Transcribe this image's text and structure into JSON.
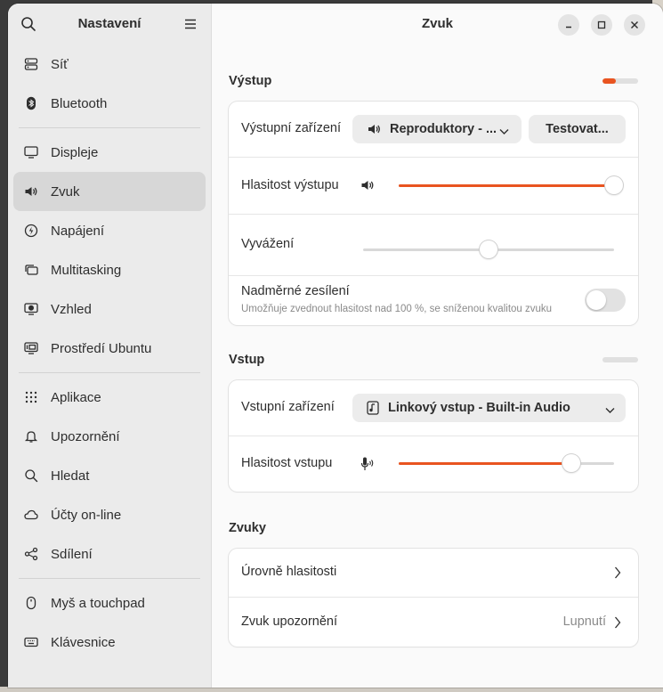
{
  "sidebar": {
    "title": "Nastavení",
    "groups": [
      [
        {
          "label": "Síť",
          "icon": "network-icon"
        },
        {
          "label": "Bluetooth",
          "icon": "bluetooth-icon"
        }
      ],
      [
        {
          "label": "Displeje",
          "icon": "display-icon"
        },
        {
          "label": "Zvuk",
          "icon": "speaker-icon",
          "active": true
        },
        {
          "label": "Napájení",
          "icon": "power-icon"
        },
        {
          "label": "Multitasking",
          "icon": "multitasking-icon"
        },
        {
          "label": "Vzhled",
          "icon": "appearance-icon"
        },
        {
          "label": "Prostředí Ubuntu",
          "icon": "ubuntu-desktop-icon"
        }
      ],
      [
        {
          "label": "Aplikace",
          "icon": "apps-grid-icon"
        },
        {
          "label": "Upozornění",
          "icon": "bell-icon"
        },
        {
          "label": "Hledat",
          "icon": "search-icon"
        },
        {
          "label": "Účty on-line",
          "icon": "cloud-icon"
        },
        {
          "label": "Sdílení",
          "icon": "share-icon"
        }
      ],
      [
        {
          "label": "Myš a touchpad",
          "icon": "mouse-icon"
        },
        {
          "label": "Klávesnice",
          "icon": "keyboard-icon"
        }
      ]
    ]
  },
  "main": {
    "title": "Zvuk",
    "output": {
      "title": "Výstup",
      "level": 0.38,
      "device_label": "Výstupní zařízení",
      "device_value": "Reproduktory - ...",
      "test_label": "Testovat...",
      "volume_label": "Hlasitost výstupu",
      "volume": 1.0,
      "balance_label": "Vyvážení",
      "balance": 0.5,
      "overamp_label": "Nadměrné zesílení",
      "overamp_desc": "Umožňuje zvednout hlasitost nad 100 %, se sníženou kvalitou zvuku",
      "overamp_on": false
    },
    "input": {
      "title": "Vstup",
      "level": 0.0,
      "device_label": "Vstupní zařízení",
      "device_value": "Linkový vstup - Built-in Audio",
      "volume_label": "Hlasitost vstupu",
      "volume": 0.8
    },
    "sounds": {
      "title": "Zvuky",
      "volume_levels_label": "Úrovně hlasitosti",
      "alert_label": "Zvuk upozornění",
      "alert_value": "Lupnutí"
    }
  },
  "colors": {
    "accent": "#e95420"
  }
}
